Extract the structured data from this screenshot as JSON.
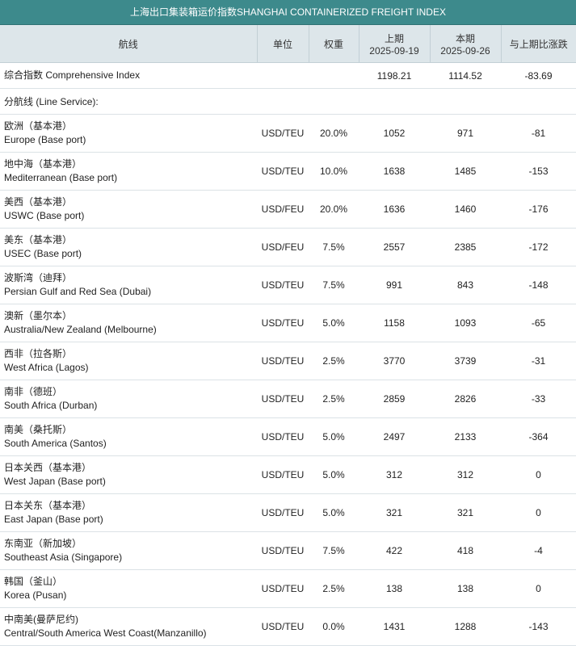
{
  "title": "上海出口集装箱运价指数SHANGHAI CONTAINERIZED FREIGHT INDEX",
  "headers": {
    "route": "航线",
    "unit": "单位",
    "weight": "权重",
    "prev_label": "上期",
    "prev_date": "2025-09-19",
    "cur_label": "本期",
    "cur_date": "2025-09-26",
    "change": "与上期比涨跌"
  },
  "composite": {
    "label": "综合指数 Comprehensive Index",
    "prev": "1198.21",
    "cur": "1114.52",
    "change": "-83.69"
  },
  "section_label": "分航线 (Line Service):",
  "rows": [
    {
      "cn": "欧洲（基本港）",
      "en": "Europe (Base port)",
      "unit": "USD/TEU",
      "weight": "20.0%",
      "prev": "1052",
      "cur": "971",
      "change": "-81"
    },
    {
      "cn": "地中海（基本港）",
      "en": "Mediterranean (Base port)",
      "unit": "USD/TEU",
      "weight": "10.0%",
      "prev": "1638",
      "cur": "1485",
      "change": "-153"
    },
    {
      "cn": "美西（基本港）",
      "en": "USWC (Base port)",
      "unit": "USD/FEU",
      "weight": "20.0%",
      "prev": "1636",
      "cur": "1460",
      "change": "-176"
    },
    {
      "cn": "美东（基本港）",
      "en": "USEC (Base port)",
      "unit": "USD/FEU",
      "weight": "7.5%",
      "prev": "2557",
      "cur": "2385",
      "change": "-172"
    },
    {
      "cn": "波斯湾（迪拜）",
      "en": "Persian Gulf and Red Sea (Dubai)",
      "unit": "USD/TEU",
      "weight": "7.5%",
      "prev": "991",
      "cur": "843",
      "change": "-148"
    },
    {
      "cn": "澳新（墨尔本）",
      "en": "Australia/New Zealand (Melbourne)",
      "unit": "USD/TEU",
      "weight": "5.0%",
      "prev": "1158",
      "cur": "1093",
      "change": "-65"
    },
    {
      "cn": "西非（拉各斯）",
      "en": "West Africa (Lagos)",
      "unit": "USD/TEU",
      "weight": "2.5%",
      "prev": "3770",
      "cur": "3739",
      "change": "-31"
    },
    {
      "cn": "南非（德班）",
      "en": "South Africa (Durban)",
      "unit": "USD/TEU",
      "weight": "2.5%",
      "prev": "2859",
      "cur": "2826",
      "change": "-33"
    },
    {
      "cn": "南美（桑托斯）",
      "en": "South America (Santos)",
      "unit": "USD/TEU",
      "weight": "5.0%",
      "prev": "2497",
      "cur": "2133",
      "change": "-364"
    },
    {
      "cn": "日本关西（基本港）",
      "en": "West Japan (Base port)",
      "unit": "USD/TEU",
      "weight": "5.0%",
      "prev": "312",
      "cur": "312",
      "change": "0"
    },
    {
      "cn": "日本关东（基本港）",
      "en": "East Japan (Base port)",
      "unit": "USD/TEU",
      "weight": "5.0%",
      "prev": "321",
      "cur": "321",
      "change": "0"
    },
    {
      "cn": "东南亚（新加坡）",
      "en": "Southeast Asia (Singapore)",
      "unit": "USD/TEU",
      "weight": "7.5%",
      "prev": "422",
      "cur": "418",
      "change": "-4"
    },
    {
      "cn": "韩国（釜山）",
      "en": "Korea (Pusan)",
      "unit": "USD/TEU",
      "weight": "2.5%",
      "prev": "138",
      "cur": "138",
      "change": "0"
    },
    {
      "cn": "中南美(曼萨尼约)",
      "en": "Central/South America West Coast(Manzanillo)",
      "unit": "USD/TEU",
      "weight": "0.0%",
      "prev": "1431",
      "cur": "1288",
      "change": "-143"
    }
  ]
}
